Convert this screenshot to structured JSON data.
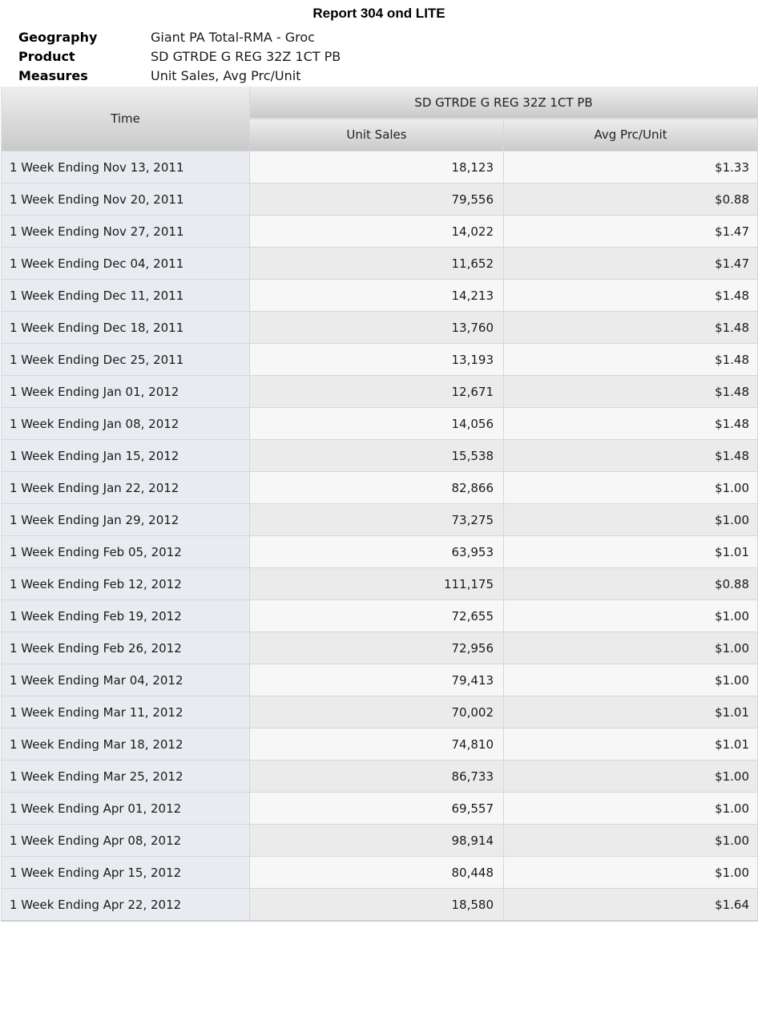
{
  "report": {
    "title": "Report 304 ond LITE"
  },
  "meta": {
    "geography_label": "Geography",
    "geography_value": "Giant PA Total-RMA - Groc",
    "product_label": "Product",
    "product_value": "SD GTRDE G REG 32Z 1CT PB",
    "measures_label": "Measures",
    "measures_value": "Unit Sales, Avg Prc/Unit"
  },
  "table": {
    "time_header": "Time",
    "group_header": "SD GTRDE G REG 32Z 1CT PB",
    "columns": [
      "Unit Sales",
      "Avg Prc/Unit"
    ],
    "rows": [
      {
        "time": "1 Week Ending Nov 13, 2011",
        "unit_sales": "18,123",
        "avg_price": "$1.33"
      },
      {
        "time": "1 Week Ending Nov 20, 2011",
        "unit_sales": "79,556",
        "avg_price": "$0.88"
      },
      {
        "time": "1 Week Ending Nov 27, 2011",
        "unit_sales": "14,022",
        "avg_price": "$1.47"
      },
      {
        "time": "1 Week Ending Dec 04, 2011",
        "unit_sales": "11,652",
        "avg_price": "$1.47"
      },
      {
        "time": "1 Week Ending Dec 11, 2011",
        "unit_sales": "14,213",
        "avg_price": "$1.48"
      },
      {
        "time": "1 Week Ending Dec 18, 2011",
        "unit_sales": "13,760",
        "avg_price": "$1.48"
      },
      {
        "time": "1 Week Ending Dec 25, 2011",
        "unit_sales": "13,193",
        "avg_price": "$1.48"
      },
      {
        "time": "1 Week Ending Jan 01, 2012",
        "unit_sales": "12,671",
        "avg_price": "$1.48"
      },
      {
        "time": "1 Week Ending Jan 08, 2012",
        "unit_sales": "14,056",
        "avg_price": "$1.48"
      },
      {
        "time": "1 Week Ending Jan 15, 2012",
        "unit_sales": "15,538",
        "avg_price": "$1.48"
      },
      {
        "time": "1 Week Ending Jan 22, 2012",
        "unit_sales": "82,866",
        "avg_price": "$1.00"
      },
      {
        "time": "1 Week Ending Jan 29, 2012",
        "unit_sales": "73,275",
        "avg_price": "$1.00"
      },
      {
        "time": "1 Week Ending Feb 05, 2012",
        "unit_sales": "63,953",
        "avg_price": "$1.01"
      },
      {
        "time": "1 Week Ending Feb 12, 2012",
        "unit_sales": "111,175",
        "avg_price": "$0.88"
      },
      {
        "time": "1 Week Ending Feb 19, 2012",
        "unit_sales": "72,655",
        "avg_price": "$1.00"
      },
      {
        "time": "1 Week Ending Feb 26, 2012",
        "unit_sales": "72,956",
        "avg_price": "$1.00"
      },
      {
        "time": "1 Week Ending Mar 04, 2012",
        "unit_sales": "79,413",
        "avg_price": "$1.00"
      },
      {
        "time": "1 Week Ending Mar 11, 2012",
        "unit_sales": "70,002",
        "avg_price": "$1.01"
      },
      {
        "time": "1 Week Ending Mar 18, 2012",
        "unit_sales": "74,810",
        "avg_price": "$1.01"
      },
      {
        "time": "1 Week Ending Mar 25, 2012",
        "unit_sales": "86,733",
        "avg_price": "$1.00"
      },
      {
        "time": "1 Week Ending Apr 01, 2012",
        "unit_sales": "69,557",
        "avg_price": "$1.00"
      },
      {
        "time": "1 Week Ending Apr 08, 2012",
        "unit_sales": "98,914",
        "avg_price": "$1.00"
      },
      {
        "time": "1 Week Ending Apr 15, 2012",
        "unit_sales": "80,448",
        "avg_price": "$1.00"
      },
      {
        "time": "1 Week Ending Apr 22, 2012",
        "unit_sales": "18,580",
        "avg_price": "$1.64"
      }
    ]
  },
  "colors": {
    "time_cell_bg": "#e8ecf0",
    "odd_row_bg": "#f7f7f7",
    "even_row_bg": "#ebebeb",
    "header_gradient_top": "#eeeeee",
    "header_gradient_bottom": "#c9c9c9"
  }
}
